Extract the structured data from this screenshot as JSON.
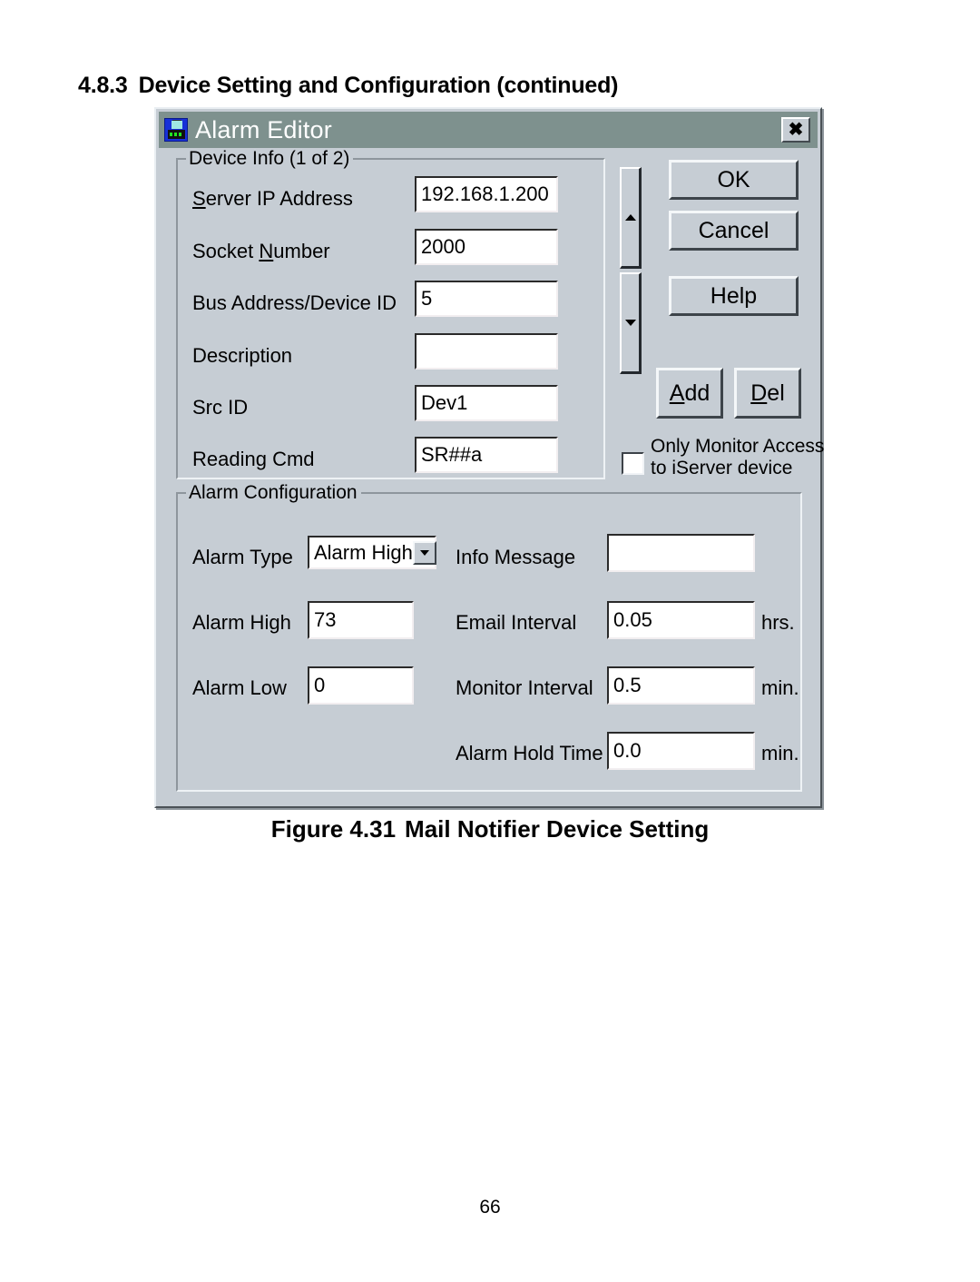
{
  "document": {
    "section_number": "4.8.3",
    "section_title": "Device Setting and Configuration (continued)",
    "figure_number": "Figure 4.31",
    "figure_title": "Mail Notifier Device Setting",
    "page_number": "66"
  },
  "dialog": {
    "title": "Alarm Editor",
    "icon": "device-icon",
    "close_label": "✖"
  },
  "device_info": {
    "legend": "Device Info  (1 of 2)",
    "fields": [
      {
        "label_pre": "S",
        "label_post": "erver IP Address",
        "value": "192.168.1.200"
      },
      {
        "label_pre": "N",
        "label_post": "umber",
        "value": "2000"
      },
      {
        "label_pre": "",
        "label_post": "Bus Address/Device ID",
        "value": "5"
      },
      {
        "label_pre": "",
        "label_post": "Description",
        "value": ""
      },
      {
        "label_pre": "",
        "label_post": "Src ID",
        "value": "Dev1"
      },
      {
        "label_pre": "",
        "label_post": "Reading Cmd",
        "value": "SR##a"
      }
    ],
    "server_ip_label_lead": "S",
    "server_ip_label_rest": "erver IP Address",
    "server_ip_value": "192.168.1.200",
    "socket_label_lead": "Socket ",
    "socket_label_acc": "N",
    "socket_label_rest": "umber",
    "socket_value": "2000",
    "bus_label": "Bus Address/Device ID",
    "bus_value": "5",
    "description_label": "Description",
    "description_value": "",
    "src_id_label": "Src ID",
    "src_id_value": "Dev1",
    "reading_cmd_label": "Reading Cmd",
    "reading_cmd_value": "SR##a"
  },
  "buttons": {
    "ok": "OK",
    "cancel": "Cancel",
    "help": "Help",
    "add_acc": "A",
    "add_rest": "dd",
    "del_acc": "D",
    "del_rest": "el"
  },
  "spinner": {
    "up_icon": "triangle-up-icon",
    "down_icon": "triangle-down-icon"
  },
  "monitor_access": {
    "line1": "Only Monitor Access",
    "line2": "to iServer device",
    "checked": false
  },
  "alarm_config": {
    "legend": "Alarm Configuration",
    "alarm_type_label": "Alarm Type",
    "alarm_type_value": "Alarm High",
    "alarm_high_label": "Alarm High",
    "alarm_high_value": "73",
    "alarm_low_label": "Alarm Low",
    "alarm_low_value": "0",
    "info_message_label": "Info Message",
    "info_message_value": "",
    "email_interval_label": "Email Interval",
    "email_interval_value": "0.05",
    "email_interval_unit": "hrs.",
    "monitor_interval_label": "Monitor Interval",
    "monitor_interval_value": "0.5",
    "monitor_interval_unit": "min.",
    "alarm_hold_label": "Alarm Hold Time",
    "alarm_hold_value": "0.0",
    "alarm_hold_unit": "min."
  },
  "colors": {
    "titlebar": "#7e918e",
    "dialog_face": "#c6cdd4",
    "field_bg": "#ffffff",
    "text": "#000000",
    "title_text": "#ffffff",
    "icon_blue": "#1730d8",
    "icon_led_green": "#21e421"
  }
}
